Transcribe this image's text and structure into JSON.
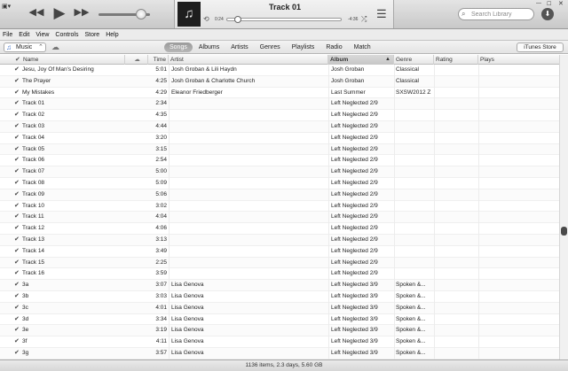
{
  "player": {
    "app_menu_glyph": "▣▾",
    "prev_glyph": "◀◀",
    "play_glyph": "▶",
    "next_glyph": "▶▶",
    "volume_level": 0.83
  },
  "now_playing": {
    "artwork_glyph": "♫",
    "title": "Track 01",
    "elapsed": "0:24",
    "remaining": "-4:36",
    "progress": 0.09,
    "repeat_glyph": "⟲",
    "shuffle_glyph": "⤮",
    "upnext_glyph": "☰"
  },
  "search": {
    "placeholder": "Search Library"
  },
  "window": {
    "minimize": "—",
    "maximize": "☐",
    "close": "✕",
    "download_glyph": "⬇"
  },
  "menubar": [
    "File",
    "Edit",
    "View",
    "Controls",
    "Store",
    "Help"
  ],
  "nav": {
    "source_label": "Music",
    "source_chevron": "⌃",
    "music_glyph": "♫",
    "cloud_glyph": "☁",
    "tabs": [
      {
        "label": "Songs",
        "active": true
      },
      {
        "label": "Albums",
        "active": false
      },
      {
        "label": "Artists",
        "active": false
      },
      {
        "label": "Genres",
        "active": false
      },
      {
        "label": "Playlists",
        "active": false
      },
      {
        "label": "Radio",
        "active": false
      },
      {
        "label": "Match",
        "active": false
      }
    ],
    "store_label": "iTunes Store"
  },
  "table": {
    "check_glyph": "✔",
    "cloud_col_glyph": "☁",
    "headers": {
      "name": "Name",
      "time": "Time",
      "artist": "Artist",
      "album": "Album",
      "genre": "Genre",
      "rating": "Rating",
      "plays": "Plays"
    },
    "sort_arrow": "▲",
    "rows": [
      {
        "name": "Jesu, Joy Of Man's Desiring",
        "time": "5:01",
        "artist": "Josh Groban & Lili Haydn",
        "album": "Josh Groban",
        "genre": "Classical"
      },
      {
        "name": "The Prayer",
        "time": "4:25",
        "artist": "Josh Groban & Charlotte Church",
        "album": "Josh Groban",
        "genre": "Classical"
      },
      {
        "name": "My Mistakes",
        "time": "4:29",
        "artist": "Eleanor Friedberger",
        "album": "Last Summer",
        "genre": "SXSW2012 Z"
      },
      {
        "name": "Track 01",
        "time": "2:34",
        "artist": "",
        "album": "Left Neglected 2/9",
        "genre": ""
      },
      {
        "name": "Track 02",
        "time": "4:35",
        "artist": "",
        "album": "Left Neglected 2/9",
        "genre": ""
      },
      {
        "name": "Track 03",
        "time": "4:44",
        "artist": "",
        "album": "Left Neglected 2/9",
        "genre": ""
      },
      {
        "name": "Track 04",
        "time": "3:20",
        "artist": "",
        "album": "Left Neglected 2/9",
        "genre": ""
      },
      {
        "name": "Track 05",
        "time": "3:15",
        "artist": "",
        "album": "Left Neglected 2/9",
        "genre": ""
      },
      {
        "name": "Track 06",
        "time": "2:54",
        "artist": "",
        "album": "Left Neglected 2/9",
        "genre": ""
      },
      {
        "name": "Track 07",
        "time": "5:00",
        "artist": "",
        "album": "Left Neglected 2/9",
        "genre": ""
      },
      {
        "name": "Track 08",
        "time": "5:09",
        "artist": "",
        "album": "Left Neglected 2/9",
        "genre": ""
      },
      {
        "name": "Track 09",
        "time": "5:06",
        "artist": "",
        "album": "Left Neglected 2/9",
        "genre": ""
      },
      {
        "name": "Track 10",
        "time": "3:02",
        "artist": "",
        "album": "Left Neglected 2/9",
        "genre": ""
      },
      {
        "name": "Track 11",
        "time": "4:04",
        "artist": "",
        "album": "Left Neglected 2/9",
        "genre": ""
      },
      {
        "name": "Track 12",
        "time": "4:06",
        "artist": "",
        "album": "Left Neglected 2/9",
        "genre": ""
      },
      {
        "name": "Track 13",
        "time": "3:13",
        "artist": "",
        "album": "Left Neglected 2/9",
        "genre": ""
      },
      {
        "name": "Track 14",
        "time": "3:49",
        "artist": "",
        "album": "Left Neglected 2/9",
        "genre": ""
      },
      {
        "name": "Track 15",
        "time": "2:25",
        "artist": "",
        "album": "Left Neglected 2/9",
        "genre": ""
      },
      {
        "name": "Track 16",
        "time": "3:59",
        "artist": "",
        "album": "Left Neglected 2/9",
        "genre": ""
      },
      {
        "name": "3a",
        "time": "3:07",
        "artist": "Lisa Genova",
        "album": "Left Neglected 3/9",
        "genre": "Spoken &..."
      },
      {
        "name": "3b",
        "time": "3:03",
        "artist": "Lisa Genova",
        "album": "Left Neglected 3/9",
        "genre": "Spoken &..."
      },
      {
        "name": "3c",
        "time": "4:01",
        "artist": "Lisa Genova",
        "album": "Left Neglected 3/9",
        "genre": "Spoken &..."
      },
      {
        "name": "3d",
        "time": "3:34",
        "artist": "Lisa Genova",
        "album": "Left Neglected 3/9",
        "genre": "Spoken &..."
      },
      {
        "name": "3e",
        "time": "3:19",
        "artist": "Lisa Genova",
        "album": "Left Neglected 3/9",
        "genre": "Spoken &..."
      },
      {
        "name": "3f",
        "time": "4:11",
        "artist": "Lisa Genova",
        "album": "Left Neglected 3/9",
        "genre": "Spoken &..."
      },
      {
        "name": "3g",
        "time": "3:57",
        "artist": "Lisa Genova",
        "album": "Left Neglected 3/9",
        "genre": "Spoken &..."
      }
    ]
  },
  "scroll": {
    "position": 0.58,
    "thumb_fraction": 0.03
  },
  "status": {
    "summary": "1136 items, 2.3 days, 5.60 GB"
  }
}
